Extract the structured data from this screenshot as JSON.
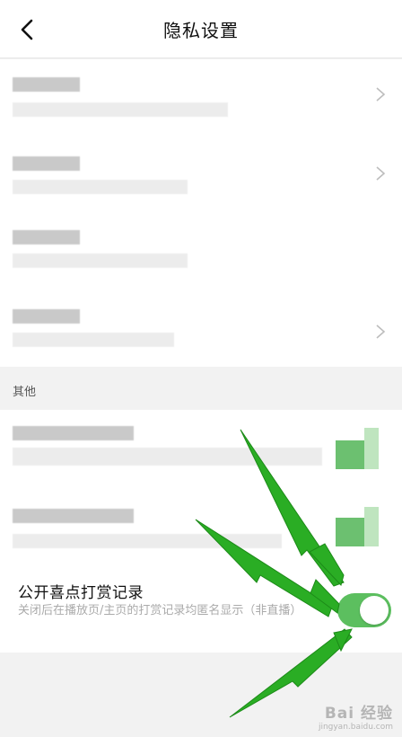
{
  "header": {
    "title": "隐私设置",
    "back_icon": "chevron-left-icon"
  },
  "section": {
    "label": "其他"
  },
  "reward_item": {
    "title": "公开喜点打赏记录",
    "description": "关闭后在播放页/主页的打赏记录均匿名显示（非直播）",
    "toggle_on": true,
    "toggle_color": "#5cbf5f"
  },
  "watermark": {
    "main": "Bai 经验",
    "sub": "jingyan.baidu.com"
  },
  "colors": {
    "arrow": "#2aad24",
    "page_bg": "#f2f2f2"
  }
}
